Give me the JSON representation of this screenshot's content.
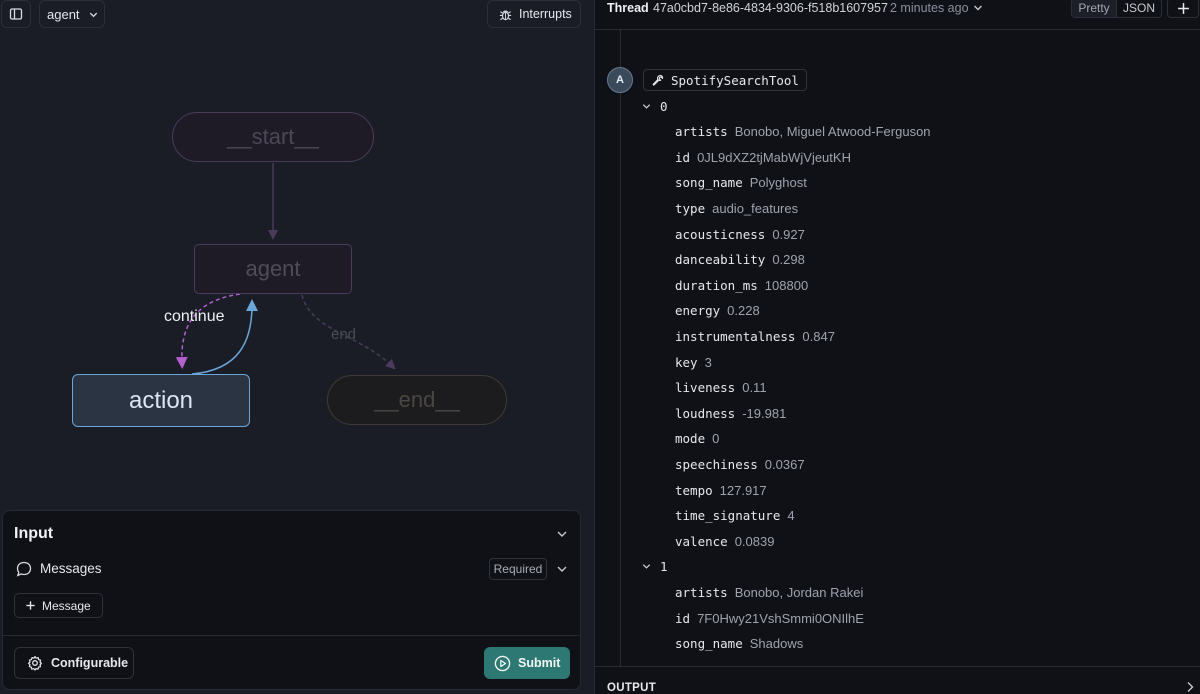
{
  "toolbar": {
    "graph_select": "agent",
    "interrupts_label": "Interrupts"
  },
  "graph": {
    "nodes": {
      "start": "__start__",
      "agent": "agent",
      "action": "action",
      "end": "__end__"
    },
    "edges": {
      "continue": "continue",
      "end": "end"
    },
    "colors": {
      "active_node_border": "#6aa6d8",
      "continue_edge": "#b45fcf",
      "return_edge": "#6aa6d8"
    }
  },
  "input_panel": {
    "title": "Input",
    "messages_label": "Messages",
    "required_badge": "Required",
    "add_message_label": "Message",
    "configurable_label": "Configurable",
    "submit_label": "Submit",
    "submit_color": "#2d7873"
  },
  "thread": {
    "label": "Thread",
    "id": "47a0cbd7-8e86-4834-9306-f518b1607957",
    "time": "2 minutes ago",
    "view_pretty": "Pretty",
    "view_json": "JSON",
    "avatar_letter": "A",
    "tool_name": "SpotifySearchTool",
    "groups": [
      {
        "index": "0",
        "fields": [
          {
            "key": "artists",
            "value": "Bonobo, Miguel Atwood-Ferguson"
          },
          {
            "key": "id",
            "value": "0JL9dXZ2tjMabWjVjeutKH"
          },
          {
            "key": "song_name",
            "value": "Polyghost"
          },
          {
            "key": "type",
            "value": "audio_features"
          },
          {
            "key": "acousticness",
            "value": "0.927"
          },
          {
            "key": "danceability",
            "value": "0.298"
          },
          {
            "key": "duration_ms",
            "value": "108800"
          },
          {
            "key": "energy",
            "value": "0.228"
          },
          {
            "key": "instrumentalness",
            "value": "0.847"
          },
          {
            "key": "key",
            "value": "3"
          },
          {
            "key": "liveness",
            "value": "0.11"
          },
          {
            "key": "loudness",
            "value": "-19.981"
          },
          {
            "key": "mode",
            "value": "0"
          },
          {
            "key": "speechiness",
            "value": "0.0367"
          },
          {
            "key": "tempo",
            "value": "127.917"
          },
          {
            "key": "time_signature",
            "value": "4"
          },
          {
            "key": "valence",
            "value": "0.0839"
          }
        ]
      },
      {
        "index": "1",
        "fields": [
          {
            "key": "artists",
            "value": "Bonobo, Jordan Rakei"
          },
          {
            "key": "id",
            "value": "7F0Hwy21VshSmmi0ONIlhE"
          },
          {
            "key": "song_name",
            "value": "Shadows"
          }
        ]
      }
    ],
    "output_label": "OUTPUT"
  }
}
